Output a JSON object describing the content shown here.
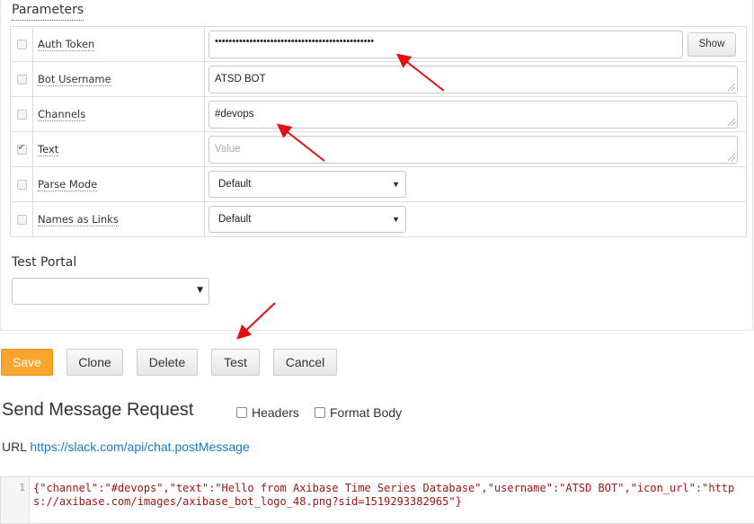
{
  "parameters": {
    "legend": "Parameters",
    "rows": [
      {
        "label": "Auth Token",
        "checked": false,
        "type": "password",
        "value": "••••••••••••••••••••••••••••••••••••••••••••••",
        "button": "Show"
      },
      {
        "label": "Bot Username",
        "checked": false,
        "type": "text",
        "value": "ATSD BOT"
      },
      {
        "label": "Channels",
        "checked": false,
        "type": "text",
        "value": "#devops"
      },
      {
        "label": "Text",
        "checked": true,
        "type": "text",
        "value": "",
        "placeholder": "Value"
      },
      {
        "label": "Parse Mode",
        "checked": false,
        "type": "select",
        "value": "Default"
      },
      {
        "label": "Names as Links",
        "checked": false,
        "type": "select",
        "value": "Default"
      }
    ]
  },
  "test_portal": {
    "label": "Test Portal",
    "value": ""
  },
  "actions": {
    "save": "Save",
    "clone": "Clone",
    "delete": "Delete",
    "test": "Test",
    "cancel": "Cancel"
  },
  "request": {
    "title": "Send Message Request",
    "headers_label": "Headers",
    "format_body_label": "Format Body",
    "url_label": "URL",
    "url": "https://slack.com/api/chat.postMessage",
    "line_number": "1",
    "body": "{\"channel\":\"#devops\",\"text\":\"Hello from Axibase Time Series Database\",\"username\":\"ATSD BOT\",\"icon_url\":\"https://axibase.com/images/axibase_bot_logo_48.png?sid=1519293382965\"}"
  },
  "colors": {
    "primary_button": "#f7a52d",
    "link": "#1a7bbf",
    "annotation_arrow": "#e01010",
    "json_string": "#a31515"
  }
}
